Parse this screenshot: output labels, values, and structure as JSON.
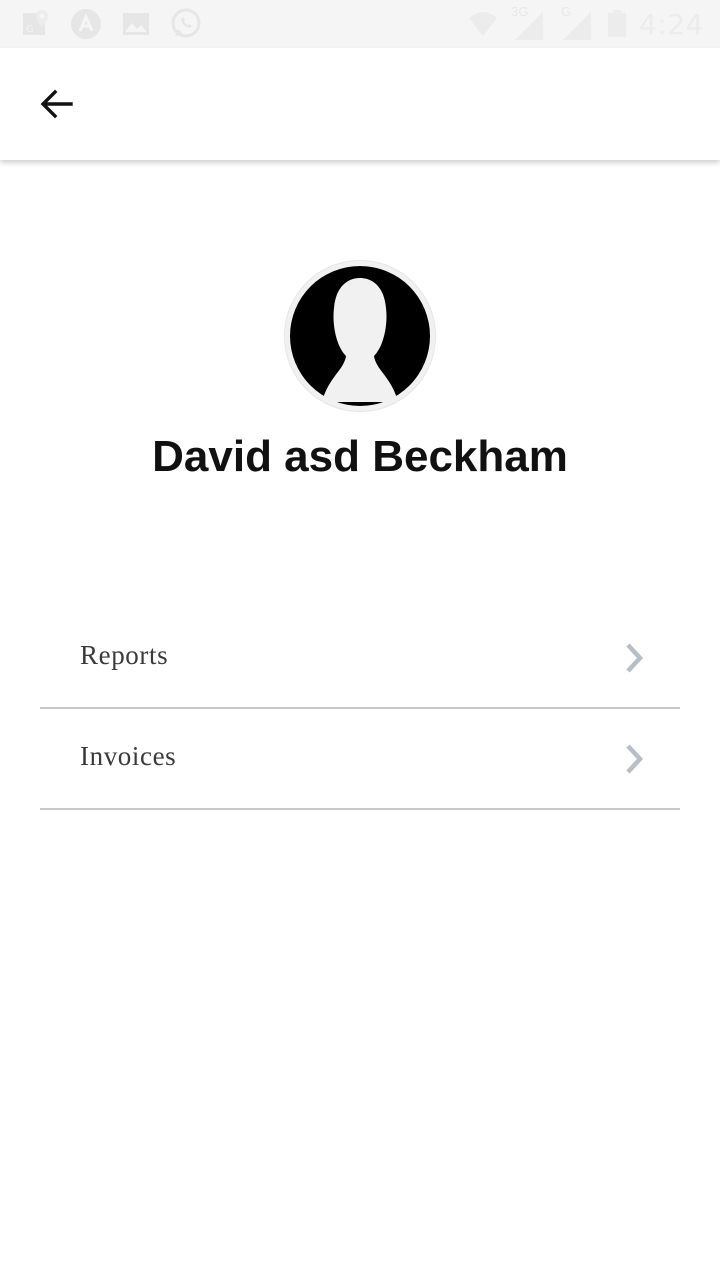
{
  "status_bar": {
    "time": "4:24",
    "network_3g": "3G",
    "network_g": "G",
    "left_icons": [
      "maps-notification-icon",
      "app-notification-icon",
      "gallery-notification-icon",
      "whatsapp-notification-icon"
    ],
    "right_icons": [
      "wifi-icon",
      "signal-3g-icon",
      "signal-g-icon",
      "battery-icon"
    ]
  },
  "app_bar": {
    "back_icon": "arrow-back-icon"
  },
  "profile": {
    "name": "David asd Beckham",
    "avatar_icon": "default-avatar-icon"
  },
  "menu": {
    "items": [
      {
        "label": "Reports",
        "icon": "chevron-right-icon"
      },
      {
        "label": "Invoices",
        "icon": "chevron-right-icon"
      }
    ]
  },
  "colors": {
    "status_bar_bg": "#f5f5f5",
    "divider": "#c8c8c8",
    "chevron": "#b8bec6",
    "name_text": "#111111"
  }
}
